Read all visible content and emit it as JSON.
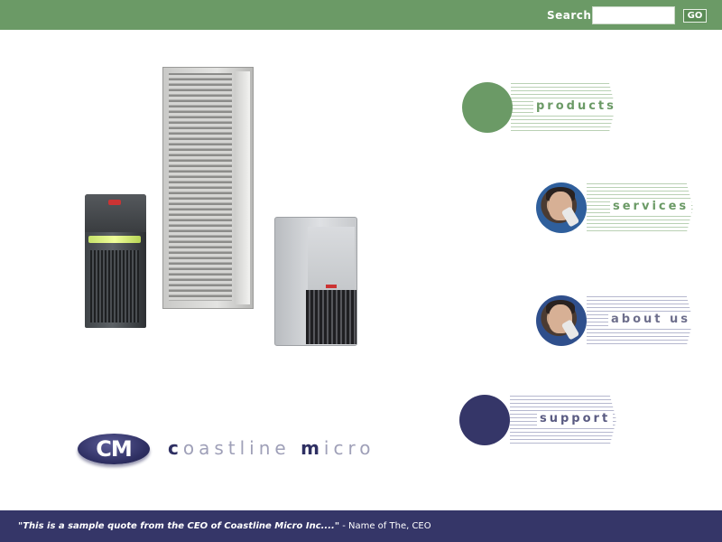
{
  "header": {
    "search_label": "Search",
    "search_value": "",
    "go_label": "GO"
  },
  "nav": {
    "products": "products",
    "services": "services",
    "about": "about us",
    "support": "support"
  },
  "logo": {
    "mark": "CM",
    "word1_initial": "c",
    "word1_rest": "oastline",
    "word2_initial": "m",
    "word2_rest": "icro"
  },
  "footer": {
    "quote": "\"This is a sample quote from the CEO of Coastline Micro Inc....\"",
    "attribution": " - Name of The, CEO"
  },
  "icons": {
    "hero": "servers-illustration",
    "services_photo": "person-on-phone-photo",
    "about_photo": "person-on-phone-photo"
  },
  "colors": {
    "green": "#6b9a66",
    "navy": "#353668"
  }
}
